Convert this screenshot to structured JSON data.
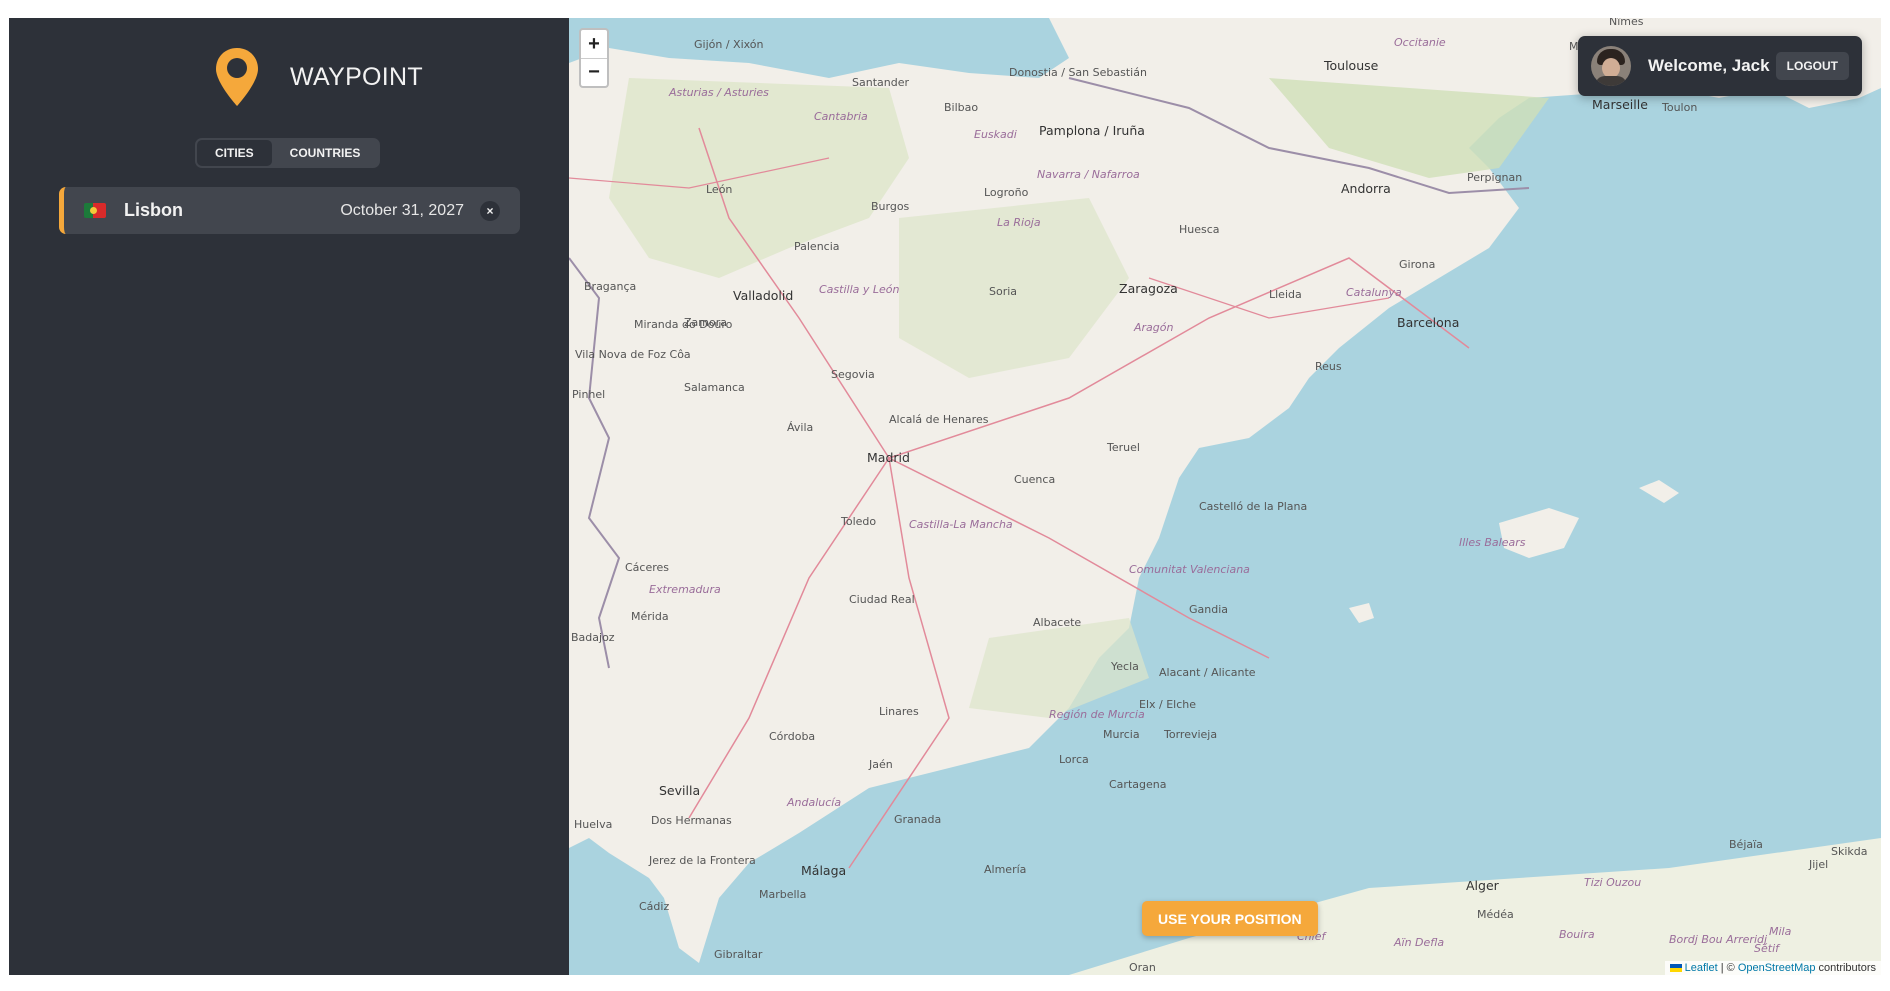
{
  "app": {
    "logo_text": "WAYPOINT",
    "accent_color": "#f5a83b",
    "sidebar_color": "#2d3139"
  },
  "tabs": [
    {
      "label": "CITIES",
      "active": true
    },
    {
      "label": "COUNTRIES",
      "active": false
    }
  ],
  "cities": [
    {
      "name": "Lisbon",
      "date": "October 31, 2027",
      "flag": "portugal-flag",
      "delete": "×"
    }
  ],
  "map": {
    "zoom_in": "+",
    "zoom_out": "−",
    "use_position_label": "USE YOUR POSITION",
    "attribution": {
      "leaflet": "Leaflet",
      "separator": " | © ",
      "osm": "OpenStreetMap",
      "suffix": " contributors"
    },
    "labels": [
      "Gijón / Xixón",
      "Santander",
      "Bilbao",
      "Donostia / San Sebastián",
      "Toulouse",
      "Occitanie",
      "Marseille",
      "Toulon",
      "Nîmes",
      "Asturias / Asturies",
      "Cantabria",
      "Euskadi",
      "Pamplona / Iruña",
      "Navarra / Nafarroa",
      "Perpignan",
      "Andorra",
      "León",
      "Burgos",
      "Logroño",
      "La Rioja",
      "Huesca",
      "Girona",
      "Palencia",
      "Bragança",
      "Valladolid",
      "Castilla y León",
      "Soria",
      "Zaragoza",
      "Lleida",
      "Catalunya",
      "Barcelona",
      "Miranda do Douro",
      "Zamora",
      "Vila Nova de Foz Côa",
      "Aragón",
      "Reus",
      "Salamanca",
      "Segovia",
      "Pinhel",
      "Alcalá de Henares",
      "Ávila",
      "Madrid",
      "Teruel",
      "Cuenca",
      "Toledo",
      "Castilla-La Mancha",
      "Castelló de la Plana",
      "Illes Balears",
      "Cáceres",
      "Extremadura",
      "Comunitat Valenciana",
      "Mérida",
      "Ciudad Real",
      "Albacete",
      "Gandia",
      "Badajoz",
      "Yecla",
      "Alacant / Alicante",
      "Elx / Elche",
      "Torrevieja",
      "Región de Murcia",
      "Murcia",
      "Linares",
      "Córdoba",
      "Jaén",
      "Lorca",
      "Cartagena",
      "Sevilla",
      "Andalucía",
      "Huelva",
      "Dos Hermanas",
      "Granada",
      "Jerez de la Frontera",
      "Málaga",
      "Almería",
      "Marbella",
      "Cádiz",
      "Gibraltar",
      "Oran",
      "Alger",
      "Médéa",
      "Chlef",
      "Aïn Defla",
      "Bouira",
      "Tizi Ouzou",
      "Béjaïa",
      "Skikda",
      "Jijel",
      "Mila",
      "Bordj Bou Arreridj",
      "Sétif",
      "Mont"
    ]
  },
  "user": {
    "welcome": "Welcome, Jack",
    "logout_label": "LOGOUT"
  }
}
